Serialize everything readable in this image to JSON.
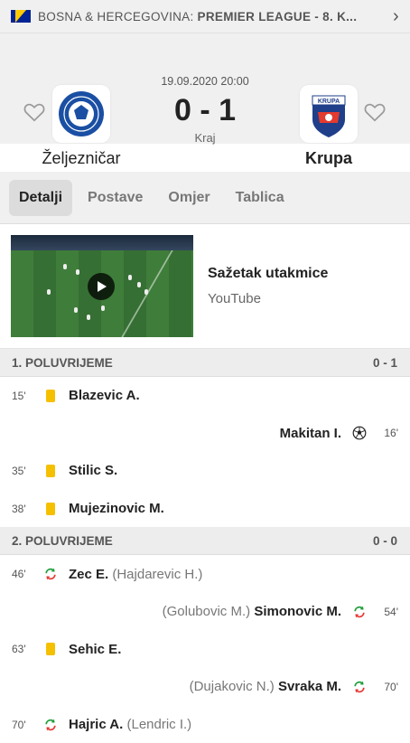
{
  "colors": {
    "yellow_card": "#f5c000",
    "sub_green": "#1f9e3a",
    "sub_red": "#e53935",
    "background": "#f0f0f0"
  },
  "header": {
    "country": "BOSNA & HERCEGOVINA:",
    "league": "PREMIER LEAGUE - 8. K...",
    "chevron": "›"
  },
  "match": {
    "datetime": "19.09.2020 20:00",
    "score": "0 - 1",
    "status": "Kraj",
    "home_team": "Željezničar",
    "away_team": "Krupa",
    "away_logo_text": "KRUPA"
  },
  "tabs": [
    "Detalji",
    "Postave",
    "Omjer",
    "Tablica"
  ],
  "video": {
    "title": "Sažetak utakmice",
    "source": "YouTube"
  },
  "sections": [
    {
      "label": "1. POLUVRIJEME",
      "score": "0 - 1"
    },
    {
      "label": "2. POLUVRIJEME",
      "score": "0 - 0"
    }
  ],
  "events": [
    {
      "minute": "15'",
      "side": "home",
      "type": "yellow-card",
      "player": "Blazevic A.",
      "sub": ""
    },
    {
      "minute": "16'",
      "side": "away",
      "type": "goal",
      "player": "Makitan I.",
      "sub": ""
    },
    {
      "minute": "35'",
      "side": "home",
      "type": "yellow-card",
      "player": "Stilic S.",
      "sub": ""
    },
    {
      "minute": "38'",
      "side": "home",
      "type": "yellow-card",
      "player": "Mujezinovic M.",
      "sub": ""
    },
    {
      "minute": "46'",
      "side": "home",
      "type": "substitution",
      "player": "Zec E.",
      "sub": "(Hajdarevic H.)"
    },
    {
      "minute": "54'",
      "side": "away",
      "type": "substitution",
      "player": "Simonovic M.",
      "sub": "(Golubovic M.)"
    },
    {
      "minute": "63'",
      "side": "home",
      "type": "yellow-card",
      "player": "Sehic E.",
      "sub": ""
    },
    {
      "minute": "70'",
      "side": "away",
      "type": "substitution",
      "player": "Svraka M.",
      "sub": "(Dujakovic N.)"
    },
    {
      "minute": "70'",
      "side": "home",
      "type": "substitution",
      "player": "Hajric A.",
      "sub": "(Lendric I.)"
    }
  ]
}
